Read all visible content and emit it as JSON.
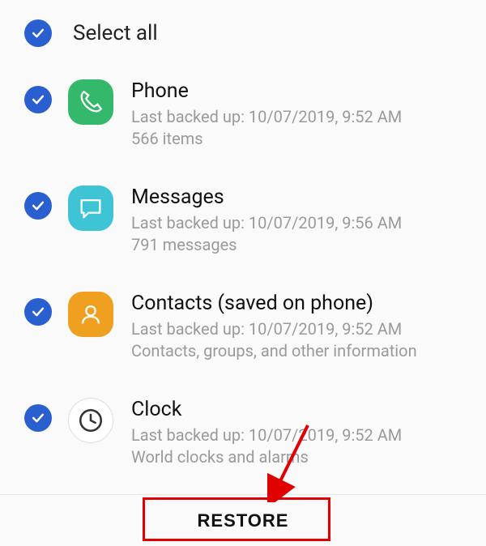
{
  "selectAll": {
    "label": "Select all",
    "checked": true
  },
  "items": [
    {
      "title": "Phone",
      "backup": "Last backed up: 10/07/2019, 9:52 AM",
      "detail": "566 items",
      "checked": true
    },
    {
      "title": "Messages",
      "backup": "Last backed up: 10/07/2019, 9:56 AM",
      "detail": "791 messages",
      "checked": true
    },
    {
      "title": "Contacts (saved on phone)",
      "backup": "Last backed up: 10/07/2019, 9:52 AM",
      "detail": "Contacts, groups, and other information",
      "checked": true
    },
    {
      "title": "Clock",
      "backup": "Last backed up: 10/07/2019, 9:52 AM",
      "detail": "World clocks and alarms",
      "checked": true
    }
  ],
  "footer": {
    "restore": "RESTORE"
  },
  "colors": {
    "checkbox": "#2a5fd0",
    "phone": "#33b86c",
    "messages": "#3fc4d6",
    "contacts": "#f0a020",
    "highlight": "#e00000"
  }
}
